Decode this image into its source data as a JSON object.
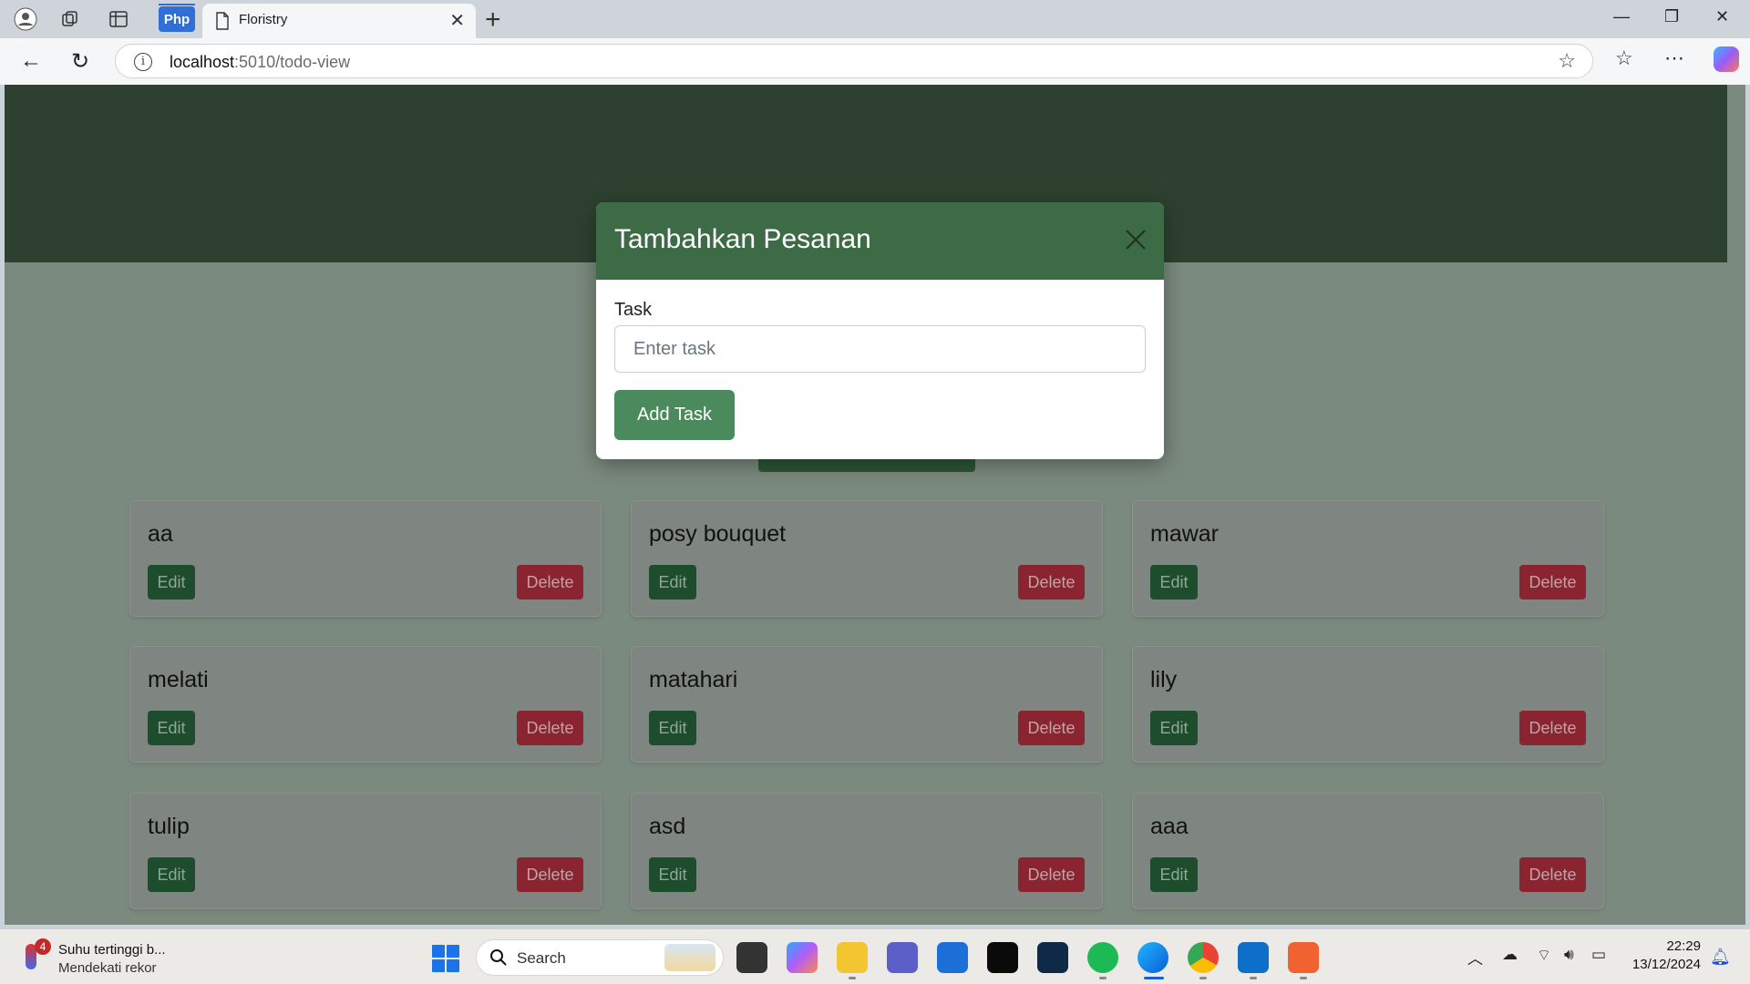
{
  "browser": {
    "php_tab_label": "Php",
    "tab_title": "Floristry",
    "url_host": "localhost",
    "url_path": ":5010/todo-view"
  },
  "page": {
    "open_modal_button": "Tambahkan Pesanan",
    "cards": [
      {
        "name": "aa",
        "edit": "Edit",
        "delete": "Delete"
      },
      {
        "name": "posy bouquet",
        "edit": "Edit",
        "delete": "Delete"
      },
      {
        "name": "mawar",
        "edit": "Edit",
        "delete": "Delete"
      },
      {
        "name": "melati",
        "edit": "Edit",
        "delete": "Delete"
      },
      {
        "name": "matahari",
        "edit": "Edit",
        "delete": "Delete"
      },
      {
        "name": "lily",
        "edit": "Edit",
        "delete": "Delete"
      },
      {
        "name": "tulip",
        "edit": "Edit",
        "delete": "Delete"
      },
      {
        "name": "asd",
        "edit": "Edit",
        "delete": "Delete"
      },
      {
        "name": "aaa",
        "edit": "Edit",
        "delete": "Delete"
      }
    ]
  },
  "modal": {
    "title": "Tambahkan Pesanan",
    "field_label": "Task",
    "field_placeholder": "Enter task",
    "field_value": "",
    "submit_label": "Add Task"
  },
  "taskbar": {
    "weather_badge": "4",
    "weather_title": "Suhu tertinggi b...",
    "weather_subtitle": "Mendekati rekor",
    "search_label": "Search",
    "time": "22:29",
    "date": "13/12/2024"
  },
  "colors": {
    "hero": "#2e4130",
    "modal_header": "#3c6b46",
    "add_button": "#4a8a5c",
    "edit_button": "#1d4d2c",
    "delete_button": "#8a2430"
  }
}
